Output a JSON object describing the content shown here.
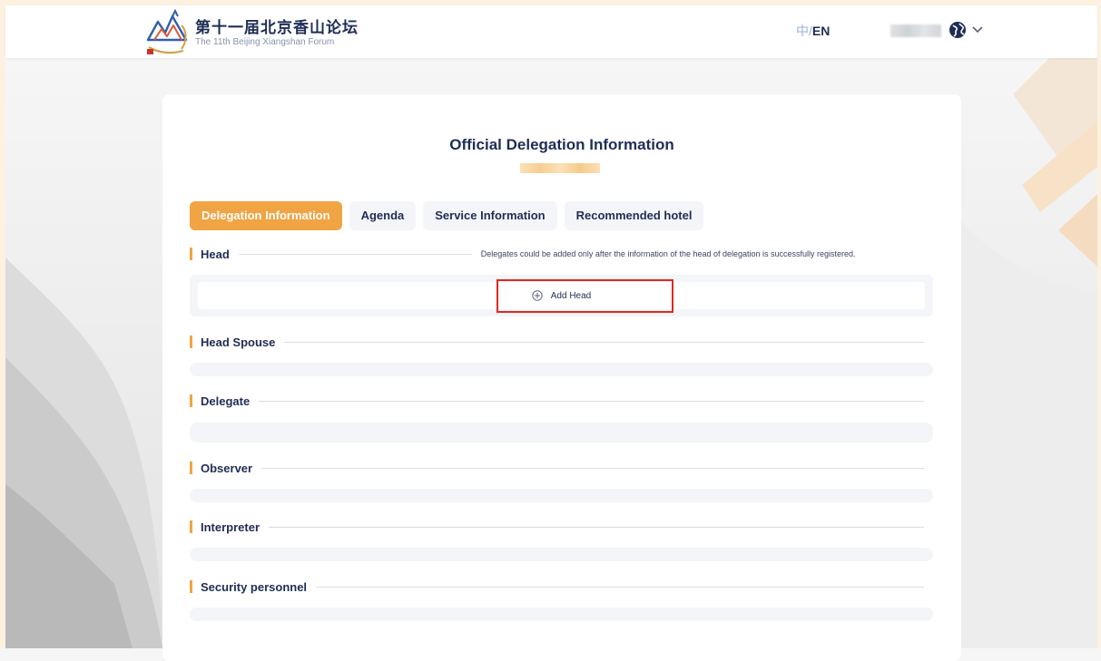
{
  "header": {
    "logo_cn": "第十一届北京香山论坛",
    "logo_en": "The 11th Beijing Xiangshan Forum",
    "lang_zh": "中",
    "lang_sep": "/",
    "lang_en": "EN"
  },
  "page": {
    "title": "Official Delegation Information"
  },
  "tabs": [
    {
      "label": "Delegation Information",
      "active": true
    },
    {
      "label": "Agenda",
      "active": false
    },
    {
      "label": "Service Information",
      "active": false
    },
    {
      "label": "Recommended hotel",
      "active": false
    }
  ],
  "sections": {
    "head": {
      "label": "Head",
      "note": "Delegates could be added only after the information of the head of delegation is successfully registered.",
      "add_label": "Add Head"
    },
    "head_spouse": {
      "label": "Head Spouse"
    },
    "delegate": {
      "label": "Delegate"
    },
    "observer": {
      "label": "Observer"
    },
    "interpreter": {
      "label": "Interpreter"
    },
    "security": {
      "label": "Security personnel"
    }
  },
  "colors": {
    "accent": "#f0a444",
    "navy": "#1f2d55",
    "highlight_box": "#e0281f"
  },
  "icons": {
    "logo": "mountain-logo-icon",
    "globe": "globe-icon",
    "chevron": "chevron-down-icon",
    "add": "plus-circle-icon"
  }
}
